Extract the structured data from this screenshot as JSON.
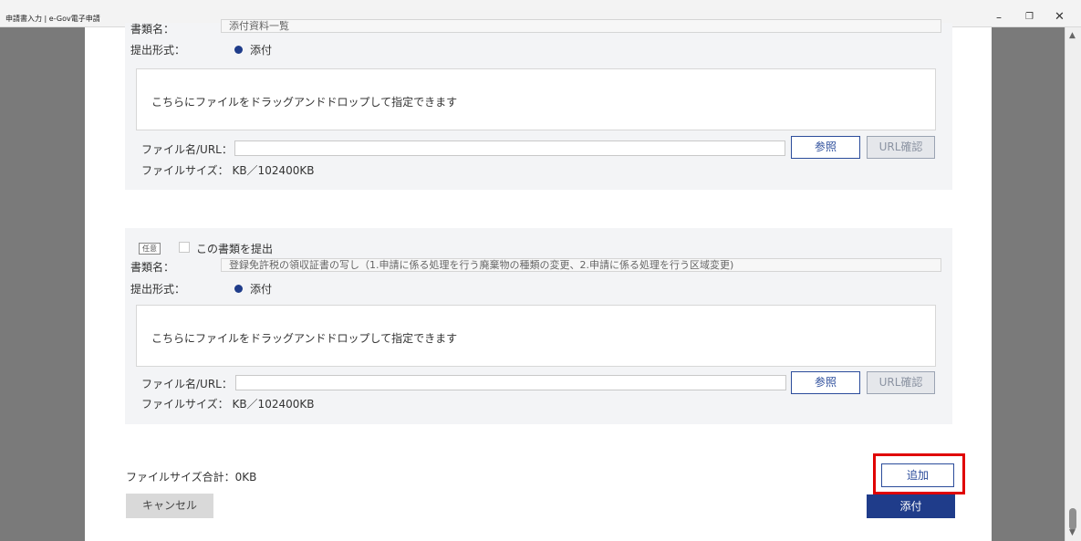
{
  "window": {
    "title": "申請書入力 | e-Gov電子申請",
    "minimize_glyph": "–",
    "restore_glyph": "❐",
    "close_glyph": "✕"
  },
  "section1": {
    "doc_name_label": "書類名：",
    "doc_name_value": "添付資料一覧",
    "submit_format_label": "提出形式：",
    "submit_format_value": "添付",
    "drop_text": "こちらにファイルをドラッグアンドドロップして指定できます",
    "file_url_label": "ファイル名/URL：",
    "file_url_value": "",
    "browse_label": "参照",
    "url_check_label": "URL確認",
    "file_size_text": "ファイルサイズ： KB／102400KB"
  },
  "section2": {
    "optional_tag": "任意",
    "submit_checkbox_label": "この書類を提出",
    "doc_name_label": "書類名：",
    "doc_name_value": "登録免許税の領収証書の写し（1.申請に係る処理を行う廃棄物の種類の変更、2.申請に係る処理を行う区域変更)",
    "submit_format_label": "提出形式：",
    "submit_format_value": "添付",
    "drop_text": "こちらにファイルをドラッグアンドドロップして指定できます",
    "file_url_label": "ファイル名/URL：",
    "file_url_value": "",
    "browse_label": "参照",
    "url_check_label": "URL確認",
    "file_size_text": "ファイルサイズ： KB／102400KB"
  },
  "footer": {
    "total_size_text": "ファイルサイズ合計：0KB",
    "add_label": "追加",
    "cancel_label": "キャンセル",
    "attach_label": "添付"
  },
  "colors": {
    "primary": "#1f3c8a",
    "highlight": "#e00000",
    "side_gray": "#7a7a7a",
    "section_bg": "#f3f4f6"
  },
  "icons": [
    "restore-icon",
    "close-icon",
    "scroll-up-icon",
    "scroll-down-icon"
  ]
}
